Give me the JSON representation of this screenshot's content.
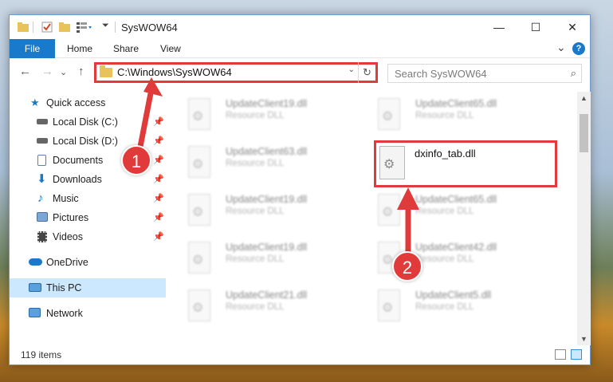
{
  "window": {
    "title": "SysWOW64",
    "controls": {
      "minimize": "—",
      "maximize": "☐",
      "close": "✕"
    }
  },
  "ribbon": {
    "tabs": [
      "File",
      "Home",
      "Share",
      "View"
    ],
    "expand_icon": "⌄",
    "help_icon": "?"
  },
  "address_bar": {
    "path": "C:\\Windows\\SysWOW64",
    "dropdown_icon": "⌄",
    "refresh_icon": "↻"
  },
  "nav": {
    "back": "←",
    "forward": "→",
    "recent": "⌄",
    "up": "↑"
  },
  "search": {
    "placeholder": "Search SysWOW64",
    "icon": "⌕"
  },
  "sidebar": {
    "items": [
      {
        "label": "Quick access",
        "icon": "star-icon",
        "pinned": false
      },
      {
        "label": "Local Disk (C:)",
        "icon": "drive-icon",
        "pinned": true
      },
      {
        "label": "Local Disk (D:)",
        "icon": "drive-icon",
        "pinned": true
      },
      {
        "label": "Documents",
        "icon": "documents-icon",
        "pinned": true
      },
      {
        "label": "Downloads",
        "icon": "downloads-icon",
        "pinned": true
      },
      {
        "label": "Music",
        "icon": "music-icon",
        "pinned": true
      },
      {
        "label": "Pictures",
        "icon": "pictures-icon",
        "pinned": true
      },
      {
        "label": "Videos",
        "icon": "videos-icon",
        "pinned": true
      },
      {
        "label": "OneDrive",
        "icon": "cloud-icon",
        "pinned": false
      },
      {
        "label": "This PC",
        "icon": "computer-icon",
        "pinned": false,
        "selected": true
      },
      {
        "label": "Network",
        "icon": "network-icon",
        "pinned": false
      }
    ],
    "pin_glyph": "📌"
  },
  "files": [
    {
      "name": "UpdateClient19.dll",
      "type": "Resource DLL"
    },
    {
      "name": "UpdateClient65.dll",
      "type": "Resource DLL"
    },
    {
      "name": "UpdateClient63.dll",
      "type": "Resource DLL"
    },
    {
      "name": "dxinfo_tab.dll",
      "type": "",
      "highlighted": true
    },
    {
      "name": "UpdateClient19.dll",
      "type": "Resource DLL"
    },
    {
      "name": "UpdateClient65.dll",
      "type": "Resource DLL"
    },
    {
      "name": "UpdateClient19.dll",
      "type": "Resource DLL"
    },
    {
      "name": "UpdateClient42.dll",
      "type": "Resource DLL"
    },
    {
      "name": "UpdateClient21.dll",
      "type": "Resource DLL"
    },
    {
      "name": "UpdateClient5.dll",
      "type": "Resource DLL"
    }
  ],
  "status": {
    "item_count": "119 items"
  },
  "annotations": [
    {
      "number": "1"
    },
    {
      "number": "2"
    }
  ],
  "colors": {
    "accent": "#1979ca",
    "annotation_red": "#e03a3a",
    "selection": "#cce8ff"
  }
}
